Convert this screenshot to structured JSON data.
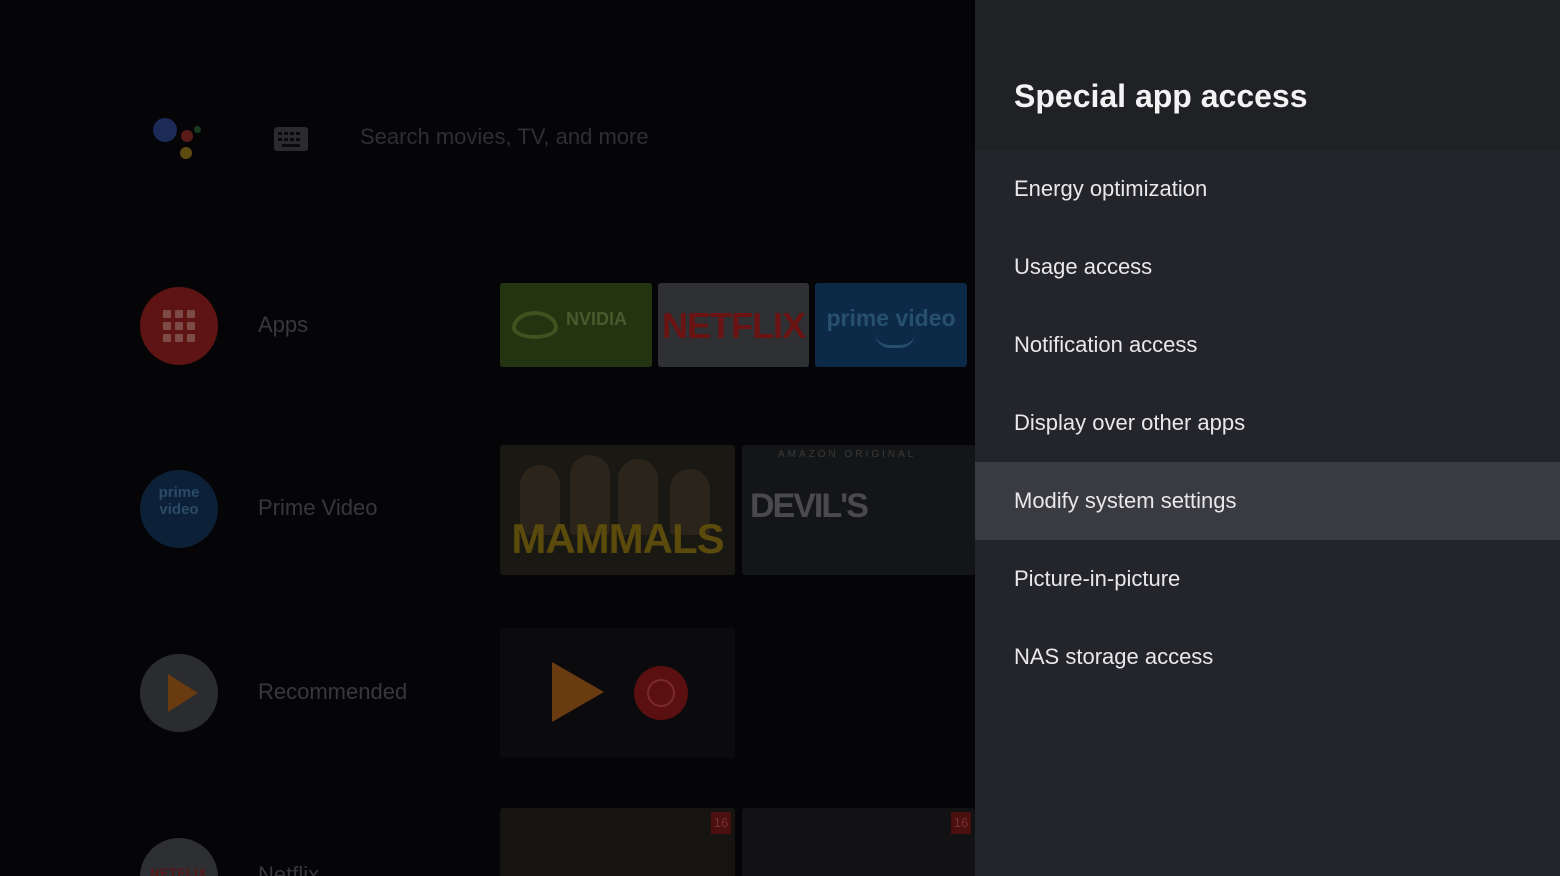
{
  "launcher": {
    "search_placeholder": "Search movies, TV, and more",
    "rows": [
      {
        "label": "Apps",
        "icon": "apps-grid-icon"
      },
      {
        "label": "Prime Video",
        "icon": "prime-video-icon"
      },
      {
        "label": "Recommended",
        "icon": "google-play-icon"
      },
      {
        "label": "Netflix",
        "icon": "netflix-icon"
      }
    ],
    "app_tiles": {
      "nvidia": "NVIDIA",
      "netflix": "NETFLIX",
      "prime": "prime video"
    },
    "prime_icon_text": "prime video",
    "netflix_icon_text": "NETFLIX",
    "content_tiles": {
      "mammals": "MAMMALS",
      "devils_top": "AMAZON ORIGINAL",
      "devils": "DEVIL'S",
      "badge": "16"
    }
  },
  "panel": {
    "title": "Special app access",
    "items": [
      {
        "label": "Energy optimization"
      },
      {
        "label": "Usage access"
      },
      {
        "label": "Notification access"
      },
      {
        "label": "Display over other apps"
      },
      {
        "label": "Modify system settings"
      },
      {
        "label": "Picture-in-picture"
      },
      {
        "label": "NAS storage access"
      }
    ],
    "focused_item": "Modify system settings"
  },
  "colors": {
    "panel_background": "#24252a",
    "panel_header": "#202125",
    "focused_row": "#3a3b41",
    "text": "#e8e8ea"
  }
}
